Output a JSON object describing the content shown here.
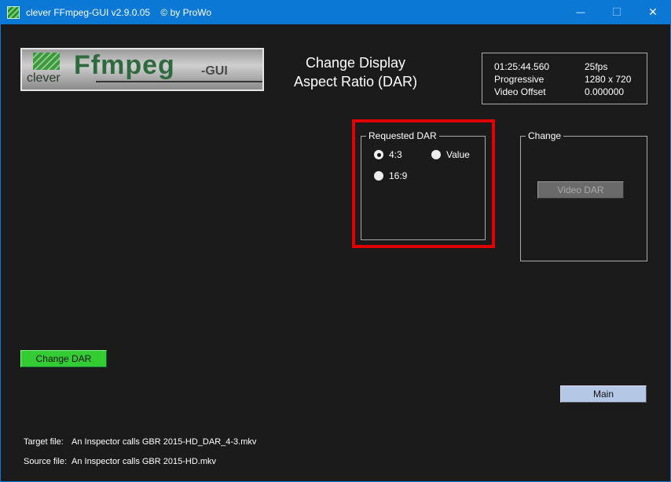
{
  "window": {
    "title": "clever FFmpeg-GUI v2.9.0.05    © by ProWo",
    "minimize": "—",
    "maximize": "☐",
    "close": "✕"
  },
  "logo": {
    "text_small": "clever",
    "text_main": "Ffmpeg",
    "text_suffix": "-GUI"
  },
  "heading": {
    "line1": "Change Display",
    "line2": "Aspect Ratio (DAR)"
  },
  "info": {
    "duration": "01:25:44.560",
    "fps": "25fps",
    "scan": "Progressive",
    "resolution": "1280 x 720",
    "offset_label": "Video Offset",
    "offset_value": "0.000000"
  },
  "requested_dar": {
    "legend": "Requested DAR",
    "options": [
      {
        "label": "4:3",
        "selected": true
      },
      {
        "label": "Value",
        "selected": false
      },
      {
        "label": "16:9",
        "selected": false
      }
    ]
  },
  "change": {
    "legend": "Change",
    "video_dar_button": "Video DAR"
  },
  "buttons": {
    "change_dar": "Change DAR",
    "main": "Main"
  },
  "files": {
    "target_label": "Target file:",
    "target_value": "An Inspector calls GBR 2015-HD_DAR_4-3.mkv",
    "source_label": "Source file:",
    "source_value": "An Inspector calls GBR 2015-HD.mkv"
  },
  "colors": {
    "titlebar": "#0a78d4",
    "highlight": "#e00000",
    "change_dar_button": "#33cc33",
    "main_button": "#b4c8e6"
  }
}
